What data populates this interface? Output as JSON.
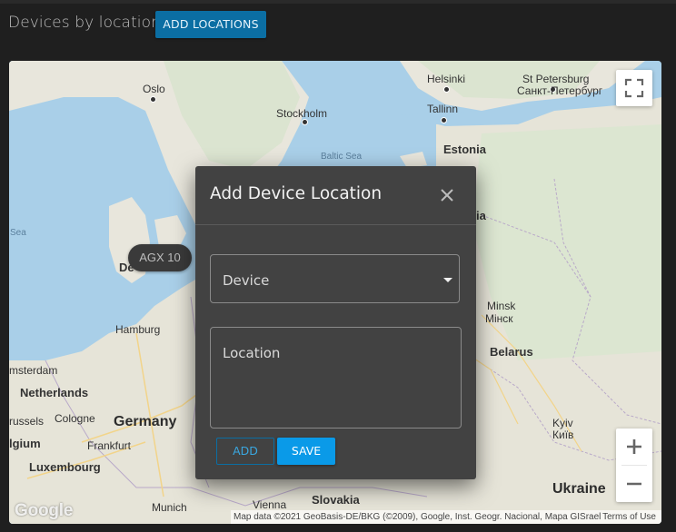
{
  "header": {
    "title": "Devices by location",
    "add_locations_label": "ADD LOCATIONS"
  },
  "map": {
    "labels": {
      "oslo": "Oslo",
      "stockholm": "Stockholm",
      "helsinki": "Helsinki",
      "st_petersburg": "St Petersburg",
      "st_petersburg_cyr": "Санкт-Петербург",
      "tallinn": "Tallinn",
      "estonia": "Estonia",
      "baltic_sea": "Baltic Sea",
      "latvia_partial": "ia",
      "sea_partial": "Sea",
      "denmark_partial": "De",
      "hamburg": "Hamburg",
      "amsterdam_partial": "msterdam",
      "netherlands": "Netherlands",
      "brussels_partial": "russels",
      "cologne": "Cologne",
      "belgium_partial": "lgium",
      "germany": "Germany",
      "frankfurt": "Frankfurt",
      "luxembourg": "Luxembourg",
      "munich": "Munich",
      "vienna": "Vienna",
      "slovakia": "Slovakia",
      "minsk": "Minsk",
      "minsk_cyr": "Мінск",
      "belarus": "Belarus",
      "kyiv": "Kyiv",
      "kyiv_cyr": "Київ",
      "ukraine": "Ukraine"
    },
    "marker_label": "AGX 10",
    "google_logo": "Google",
    "attribution": "Map data ©2021 GeoBasis-DE/BKG (©2009), Google, Inst. Geogr. Nacional, Mapa GISrael",
    "terms": "Terms of Use"
  },
  "modal": {
    "title": "Add Device Location",
    "device_label": "Device",
    "location_label": "Location",
    "add_label": "ADD",
    "save_label": "SAVE"
  },
  "colors": {
    "accent": "#0b6ea3",
    "save": "#0a9ae8",
    "modal_bg": "#424242",
    "water": "#a9cfe8",
    "land": "#e8e6dc"
  }
}
